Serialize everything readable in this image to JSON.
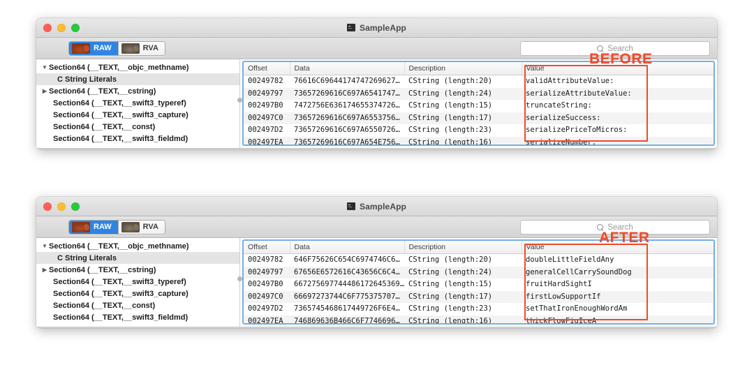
{
  "app": {
    "title": "SampleApp",
    "icon": "terminal-app-icon"
  },
  "window_controls": {
    "close": "close-button",
    "minimize": "minimize-button",
    "zoom": "zoom-button"
  },
  "toolbar": {
    "segments": [
      {
        "label": "RAW",
        "icon": "hippo-orange-icon",
        "selected": true
      },
      {
        "label": "RVA",
        "icon": "hippo-gray-icon",
        "selected": false
      }
    ],
    "search": {
      "placeholder": "Search",
      "value": "",
      "icon": "search-icon"
    }
  },
  "sidebar": {
    "items": [
      {
        "label": "Section64 (__TEXT,__objc_methname)",
        "disclosure": "▼",
        "level": 0,
        "selected": false
      },
      {
        "label": "C String Literals",
        "disclosure": "",
        "level": 1,
        "selected": true
      },
      {
        "label": "Section64 (__TEXT,__cstring)",
        "disclosure": "▶",
        "level": 0,
        "selected": false
      },
      {
        "label": "Section64 (__TEXT,__swift3_typeref)",
        "disclosure": "",
        "level": 0,
        "selected": false
      },
      {
        "label": "Section64 (__TEXT,__swift3_capture)",
        "disclosure": "",
        "level": 0,
        "selected": false
      },
      {
        "label": "Section64 (__TEXT,__const)",
        "disclosure": "",
        "level": 0,
        "selected": false
      },
      {
        "label": "Section64 (__TEXT,__swift3_fieldmd)",
        "disclosure": "",
        "level": 0,
        "selected": false
      }
    ]
  },
  "table": {
    "columns": [
      "Offset",
      "Data",
      "Description",
      "Value"
    ]
  },
  "before": {
    "annotation": "BEFORE",
    "annotation_color": "#f04a28",
    "rows": [
      {
        "offset": "00249782",
        "data": "76616C69644174747269627…",
        "description": "CString (length:20)",
        "value": "validAttributeValue:"
      },
      {
        "offset": "00249797",
        "data": "73657269616C697A6541747…",
        "description": "CString (length:24)",
        "value": "serializeAttributeValue:"
      },
      {
        "offset": "002497B0",
        "data": "7472756E636174655374726…",
        "description": "CString (length:15)",
        "value": "truncateString:"
      },
      {
        "offset": "002497C0",
        "data": "73657269616C697A6553756…",
        "description": "CString (length:17)",
        "value": "serializeSuccess:"
      },
      {
        "offset": "002497D2",
        "data": "73657269616C697A6550726…",
        "description": "CString (length:23)",
        "value": "serializePriceToMicros:"
      },
      {
        "offset": "002497EA",
        "data": "73657269616C697A654E756…",
        "description": "CString (length:16)",
        "value": "serializeNumber:"
      }
    ]
  },
  "after": {
    "annotation": "AFTER",
    "annotation_color": "#f04a28",
    "rows": [
      {
        "offset": "00249782",
        "data": "646F75626C654C6974746C6…",
        "description": "CString (length:20)",
        "value": "doubleLittleFieldAny"
      },
      {
        "offset": "00249797",
        "data": "67656E6572616C43656C6C4…",
        "description": "CString (length:24)",
        "value": "generalCellCarrySoundDog"
      },
      {
        "offset": "002497B0",
        "data": "667275697744486172645369…",
        "description": "CString (length:15)",
        "value": "fruitHardSightI"
      },
      {
        "offset": "002497C0",
        "data": "66697273744C6F775375707…",
        "description": "CString (length:17)",
        "value": "firstLowSupportIf"
      },
      {
        "offset": "002497D2",
        "data": "7365745468617449726F6E4…",
        "description": "CString (length:23)",
        "value": "setThatIronEnoughWordAm"
      },
      {
        "offset": "002497EA",
        "data": "746869636B466C6F7746696…",
        "description": "CString (length:16)",
        "value": "thickFlowFigIceA"
      }
    ]
  },
  "theme": {
    "accent_blue": "#2f84e0",
    "focus_ring": "#76aee6",
    "annotation_red": "#f04a28",
    "window_bg": "#ececec",
    "row_alt": "#f3f3f3"
  }
}
